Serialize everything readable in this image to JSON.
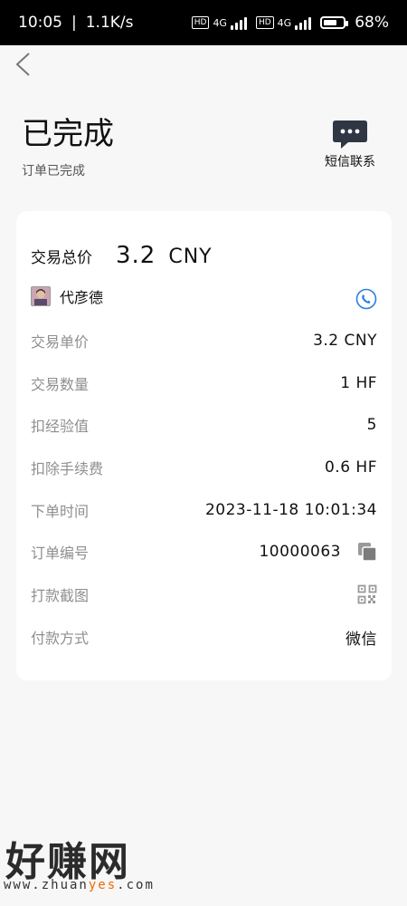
{
  "status_bar": {
    "time": "10:05",
    "speed": "1.1K/s",
    "network1": "4G",
    "network2": "4G",
    "hd_label": "HD",
    "battery_percent": "68%",
    "battery_level": 0.68
  },
  "header": {
    "title": "已完成",
    "subtitle": "订单已完成",
    "sms_label": "短信联系"
  },
  "order": {
    "total_label": "交易总价",
    "total_value": "3.2",
    "total_unit": "CNY",
    "user_name": "代彦德",
    "rows": [
      {
        "label": "交易单价",
        "value": "3.2  CNY"
      },
      {
        "label": "交易数量",
        "value": "1  HF"
      },
      {
        "label": "扣经验值",
        "value": "5"
      },
      {
        "label": "扣除手续费",
        "value": "0.6  HF"
      },
      {
        "label": "下单时间",
        "value": "2023-11-18  10:01:34"
      },
      {
        "label": "订单编号",
        "value": "10000063"
      },
      {
        "label": "打款截图",
        "value": ""
      },
      {
        "label": "付款方式",
        "value": "微信"
      }
    ]
  },
  "watermark": {
    "logo": "好赚网",
    "url_prefix": "www.zhuan",
    "url_highlight": "yes",
    "url_suffix": ".com"
  },
  "icons": {
    "back": "chevron-left-icon",
    "sms": "chat-bubble-icon",
    "phone": "phone-icon",
    "copy": "copy-icon",
    "qr": "qr-code-icon"
  },
  "colors": {
    "phone_blue": "#2a7ee0",
    "label_gray": "#8f8f8f",
    "icon_gray": "#888888",
    "watermark_orange": "#f06a00"
  }
}
